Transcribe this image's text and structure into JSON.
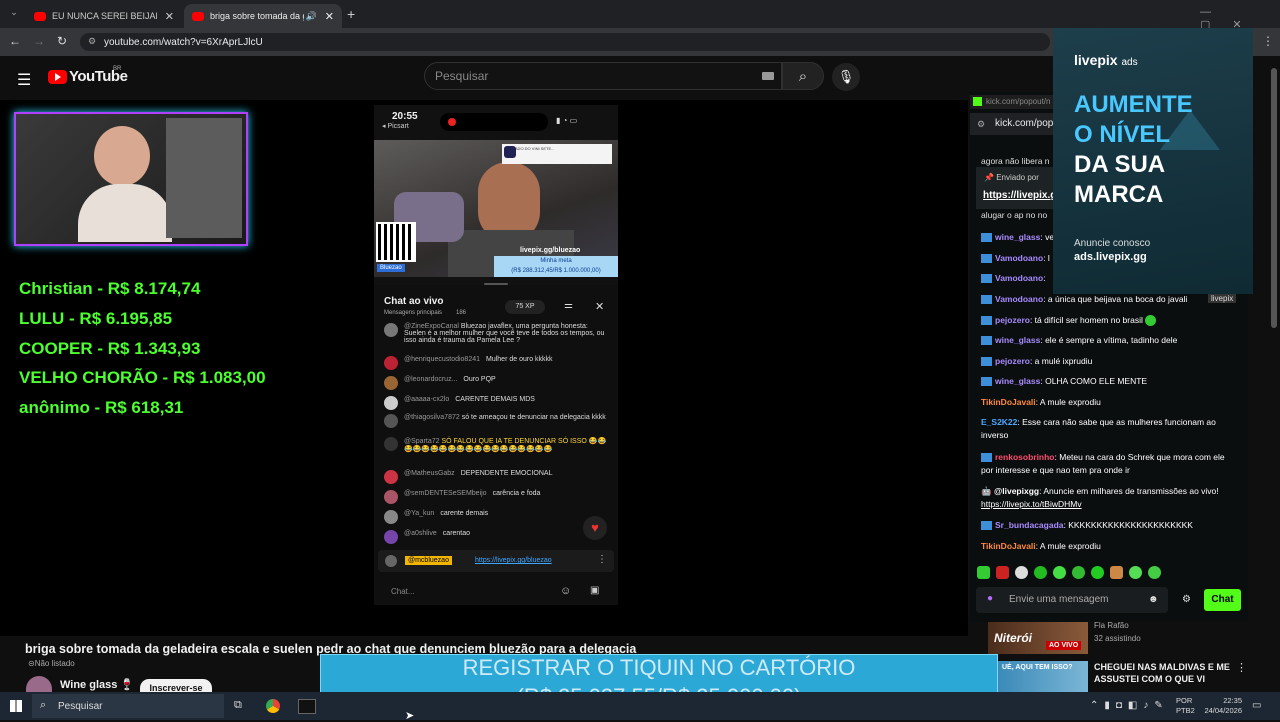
{
  "tabs": [
    {
      "label": "EU NUNCA SEREI BEIJADO PEL..."
    },
    {
      "label": "briga sobre tomada da gela..."
    }
  ],
  "address": "youtube.com/watch?v=6XrAprLJlcU",
  "youtube": {
    "logo": "YouTube",
    "region": "BR",
    "search_placeholder": "Pesquisar"
  },
  "donors": [
    "Christian - R$ 8.174,74",
    "LULU - R$ 6.195,85",
    "COOPER - R$ 1.343,93",
    "VELHO CHORÃO - R$ 1.083,00",
    "anônimo - R$ 618,31"
  ],
  "phone": {
    "time": "20:55",
    "app": "◂ Picsart",
    "channel_label": "Bluezao",
    "video_banner": "SOLDADO DO VINI SETE...",
    "donation_site": "livepix.gg/bluezao",
    "goal_label": "Minha meta",
    "goal_value": "(R$ 288.312,45/R$ 1.000.000,00)",
    "chat_title": "Chat ao vivo",
    "chat_sub": "Mensagens principais",
    "viewers": "186",
    "xp": "75 XP",
    "pinned_user": "@mcbluezao",
    "pinned_link": "https://livepix.gg/bluezao",
    "input_placeholder": "Chat...",
    "messages": [
      {
        "user": "@ZineExpoCanal",
        "text": "Bluezao javaflex, uma pergunta honesta: Suelen é a melhor mulher que você teve de todos os tempos, ou isso ainda é trauma da Pamela Lee ?"
      },
      {
        "user": "@henriquecustodio8241",
        "text": "Mulher de ouro kkkkk"
      },
      {
        "user": "@leonardocruz...",
        "text": "Ouro PQP"
      },
      {
        "user": "@aaaaa-cx2lo",
        "text": "CARENTE DEMAIS MDS"
      },
      {
        "user": "@thiagosilva7872",
        "text": "só te ameaçou te denunciar na delegacia kkkk"
      },
      {
        "user": "@Sparta72",
        "text": "SÓ FALOU QUE IA TE DENUNCIAR SÓ ISSO 😂😂😂😂😂😂😂😂😂😂😂😂😂😂😂😂😂😂😂"
      },
      {
        "user": "@MatheusGabz",
        "text": "DEPENDENTE EMOCIONAL"
      },
      {
        "user": "@semDENTESeSEMbeijo",
        "text": "carência e foda"
      },
      {
        "user": "@Ya_kun",
        "text": "carente demais"
      },
      {
        "user": "@a0shlive",
        "text": "carentao"
      }
    ]
  },
  "kick": {
    "url_small": "kick.com/popout/n",
    "url": "kick.com/popo",
    "top_text": "agora não libera n",
    "sent_by": "Enviado por",
    "pinned_link": "https://livepix.gg",
    "ahead_text": "alugar o ap no no",
    "messages": [
      {
        "user": "wine_glass",
        "color": "#a88bff",
        "text": ": ve"
      },
      {
        "user": "Vamodoano",
        "color": "#a88bff",
        "text": ": l"
      },
      {
        "user": "Vamodoano",
        "color": "#a88bff",
        "text": ": "
      },
      {
        "user": "Vamodoano",
        "color": "#a88bff",
        "text": ": a única que beijava na boca do javali"
      },
      {
        "user": "pejozero",
        "color": "#a88bff",
        "text": ": tá difícil ser homem no brasil"
      },
      {
        "user": "wine_glass",
        "color": "#a88bff",
        "text": ": ele é sempre a vítima, tadinho dele"
      },
      {
        "user": "pejozero",
        "color": "#a88bff",
        "text": ": a mulé ixprudiu"
      },
      {
        "user": "wine_glass",
        "color": "#a88bff",
        "text": ": OLHA COMO ELE MENTE"
      },
      {
        "user": "TikinDoJavali",
        "color": "#ff8a3d",
        "text": ": A mule exprodiu"
      },
      {
        "user": "E_S2K22",
        "color": "#4aa8ff",
        "text": ": Esse cara não sabe que as mulheres funcionam ao inverso"
      },
      {
        "user": "renkosobrinho",
        "color": "#ff4d6d",
        "text": ": Meteu na cara do Schrek que mora com ele por interesse e que nao tem pra onde ir"
      },
      {
        "user": "@livepixgg",
        "color": "#ffffff",
        "text": ": Anuncie em milhares de transmissões ao vivo! "
      },
      {
        "user": "Sr_bundacagada",
        "color": "#a88bff",
        "text": ": KKKKKKKKKKKKKKKKKKKKKK"
      },
      {
        "user": "TikinDoJavali",
        "color": "#ff8a3d",
        "text": ": A mule exprodiu"
      }
    ],
    "livepix_link": "https://livepix.to/tBiwDHMv",
    "input_placeholder": "Envie uma mensagem",
    "send_label": "Chat"
  },
  "ad": {
    "brand": "livepix",
    "brand_suffix": "ads",
    "headline": [
      "AUMENTE",
      "O NÍVEL",
      "DA SUA",
      "MARCA"
    ],
    "cta": "Anuncie conosco",
    "site": "ads.livepix.gg",
    "tag": "livepix"
  },
  "side_videos": [
    {
      "title": "",
      "channel": "Fla Rafão",
      "meta": "32 assistindo",
      "badge": "AO VIVO",
      "thumb_text": "Niterói"
    },
    {
      "title": "CHEGUEI NAS MALDIVAS E ME ASSUSTEI COM O QUE VI",
      "channel": "Nômade Br...",
      "meta": "",
      "badge": "",
      "thumb_text": "UÉ, AQUI TEM ISSO?"
    }
  ],
  "video_title": "briga sobre tomada da geladeira escala e suelen pedr ao chat que denunciem bluezão para a delegacia",
  "unlisted": "Não listado",
  "channel_name": "Wine glass 🍷",
  "subscribe": "Inscrever-se",
  "overlay": {
    "line1": "REGISTRAR O TIQUIN NO CARTÓRIO",
    "line2": "(R$ 25.037,55/R$ 25.000,00)"
  },
  "taskbar": {
    "search": "Pesquisar",
    "lang": "POR",
    "layout": "PTB2",
    "time": "22:35",
    "date": "24/04/2026"
  },
  "colors": {
    "accent_green": "#4cff2e",
    "kick_green": "#53fc18",
    "yt_red": "#ff0000",
    "overlay_blue": "#2ca8d6"
  }
}
